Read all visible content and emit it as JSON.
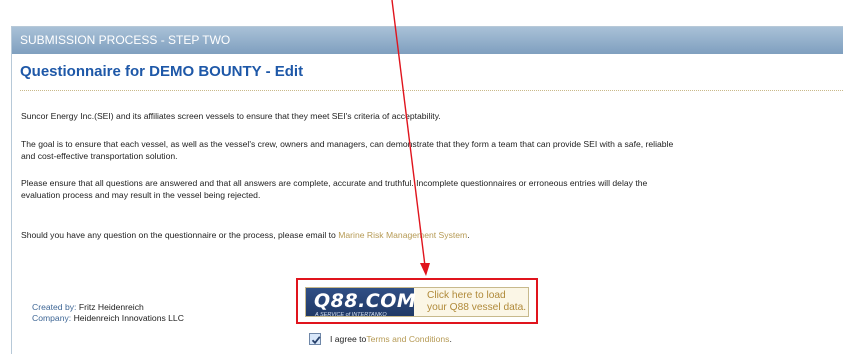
{
  "header": {
    "step_title": "SUBMISSION PROCESS - STEP TWO"
  },
  "page_title": "Questionnaire for DEMO BOUNTY - Edit",
  "paragraphs": {
    "p1": "Suncor Energy Inc.(SEI) and its affiliates screen vessels to ensure that they meet SEI's criteria of acceptability.",
    "p2_line1": "The goal is to ensure that each vessel, as well as the vessel's crew, owners and managers, can demonstrate that they form a team that can provide SEI with a safe, reliable",
    "p2_line2": "and cost-effective transportation solution.",
    "p3_line1": "Please ensure that all questions are answered and that all answers are complete, accurate and truthful. Incomplete questionnaires or erroneous entries will delay the",
    "p3_line2": "evaluation process and may result in the vessel being rejected.",
    "p4_prefix": "Should you have any question on the questionnaire or the process, please email to ",
    "p4_link": "Marine Risk Management System",
    "p4_suffix": "."
  },
  "credits": {
    "created_label": "Created by:",
    "created_value": "Fritz Heidenreich",
    "company_label": "Company:",
    "company_value": "Heidenreich Innovations LLC"
  },
  "q88": {
    "logo_text": "Q88.COM",
    "logo_sub": "A SERVICE of INTERTANKO",
    "line1": "Click here to load",
    "line2": "your Q88 vessel data.",
    "brand_color": "#203966",
    "highlight_color": "#e0141d"
  },
  "agree": {
    "checked": true,
    "prefix": "I agree to ",
    "link": "Terms and Conditions",
    "suffix": " ."
  }
}
